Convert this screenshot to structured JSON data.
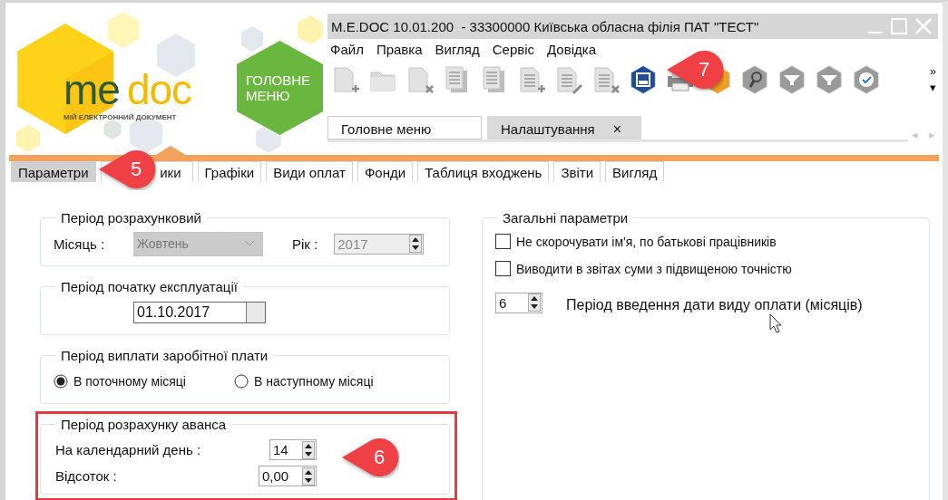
{
  "logo": {
    "wordmark_me": "me",
    "wordmark_doc": "doc",
    "tagline": "МІЙ ЕЛЕКТРОННИЙ ДОКУМЕНТ"
  },
  "main_menu_button": {
    "label": "ГОЛОВНЕ МЕНЮ"
  },
  "window": {
    "title": "M.E.DOC 10.01.200  - 33300000 Київська обласна філія ПАТ \"ТЕСТ\""
  },
  "menu": [
    {
      "label": "Файл"
    },
    {
      "label": "Правка"
    },
    {
      "label": "Вигляд"
    },
    {
      "label": "Сервіс"
    },
    {
      "label": "Довідка"
    }
  ],
  "toolbar": {
    "icons": [
      {
        "kind": "document-plus"
      },
      {
        "kind": "folder"
      },
      {
        "kind": "document-cross"
      },
      {
        "kind": "documents"
      },
      {
        "kind": "documents"
      },
      {
        "kind": "list-plus"
      },
      {
        "kind": "list-pencil"
      },
      {
        "kind": "list-cross"
      },
      {
        "kind": "hex-blue"
      },
      {
        "kind": "printer"
      },
      {
        "kind": "hex-orange"
      },
      {
        "kind": "hex-search"
      },
      {
        "kind": "hex-filter"
      },
      {
        "kind": "hex-filter"
      },
      {
        "kind": "hex-check"
      }
    ],
    "more": "»",
    "dropdown": "▾"
  },
  "document_tabs": {
    "tabs": [
      {
        "label": "Головне меню",
        "selected": false
      },
      {
        "label": "Налаштування",
        "selected": true,
        "close": "×"
      }
    ],
    "scroll_left": "◂",
    "scroll_right": "▸"
  },
  "section_tabs": [
    {
      "label": "Параметри",
      "selected": true
    },
    {
      "label": "ики",
      "selected": false
    },
    {
      "label": "Графіки",
      "selected": false
    },
    {
      "label": "Види оплат",
      "selected": false
    },
    {
      "label": "Фонди",
      "selected": false
    },
    {
      "label": "Таблиця входжень",
      "selected": false
    },
    {
      "label": "Звіти",
      "selected": false
    },
    {
      "label": "Вигляд",
      "selected": false
    }
  ],
  "left_groups": [
    {
      "title": "Період розрахунковий",
      "highlighted": false,
      "fields": [
        {
          "kind": "combo",
          "label": "Місяць :",
          "value": "Жовтень",
          "disabled": true
        },
        {
          "kind": "spin",
          "label": "Рік :",
          "value": "2017",
          "disabled": true
        }
      ]
    },
    {
      "title": "Період початку експлуатації",
      "highlighted": false,
      "fields": [
        {
          "kind": "date",
          "value": "01.10.2017"
        }
      ]
    },
    {
      "title": "Період виплати заробітної плати",
      "highlighted": false,
      "fields": [
        {
          "kind": "radio",
          "label": "В поточному місяці",
          "selected": true
        },
        {
          "kind": "radio",
          "label": "В наступному місяці",
          "selected": false
        }
      ]
    },
    {
      "title": "Період розрахунку аванса",
      "highlighted": true,
      "fields": [
        {
          "kind": "spin",
          "label": "На календарний день :",
          "value": "14",
          "disabled": false
        },
        {
          "kind": "spin",
          "label": "Відсоток :",
          "value": "0,00",
          "disabled": false
        }
      ]
    }
  ],
  "general": {
    "title": "Загальні параметри",
    "fields": [
      {
        "kind": "checkbox",
        "label": "Не скорочувати ім'я, по батькові працівників",
        "checked": false
      },
      {
        "kind": "checkbox",
        "label": "Виводити в звітах суми з підвищеною точністю",
        "checked": false
      },
      {
        "kind": "spin",
        "value": "6",
        "disabled": false,
        "caption": "Період введення дати виду оплати (місяців)"
      }
    ]
  },
  "callouts": [
    {
      "number": "7"
    },
    {
      "number": "5"
    },
    {
      "number": "6"
    }
  ]
}
